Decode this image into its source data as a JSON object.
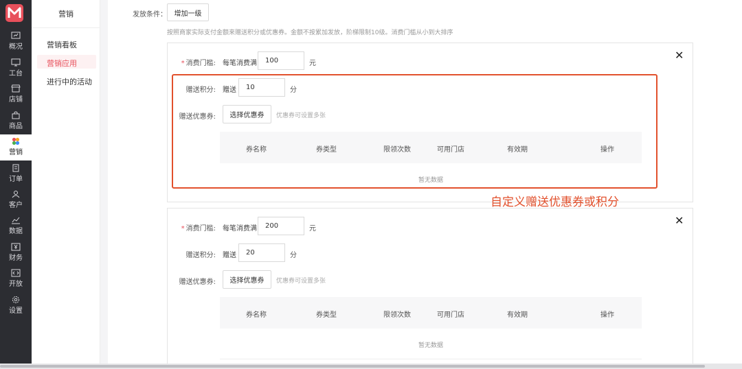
{
  "rail": {
    "items": [
      {
        "label": "概况",
        "icon": "overview-icon"
      },
      {
        "label": "工台",
        "icon": "monitor-icon"
      },
      {
        "label": "店铺",
        "icon": "store-icon"
      },
      {
        "label": "商品",
        "icon": "bag-icon"
      },
      {
        "label": "营销",
        "icon": "marketing-icon"
      },
      {
        "label": "订单",
        "icon": "order-icon"
      },
      {
        "label": "客户",
        "icon": "user-icon"
      },
      {
        "label": "数据",
        "icon": "chart-icon"
      },
      {
        "label": "财务",
        "icon": "finance-icon"
      },
      {
        "label": "开放",
        "icon": "code-icon"
      },
      {
        "label": "设置",
        "icon": "gear-icon"
      }
    ],
    "active": "营销"
  },
  "submenu": {
    "title": "营销",
    "items": [
      "营销看板",
      "营销应用",
      "进行中的活动"
    ],
    "active": "营销应用"
  },
  "form": {
    "condition_label": "发放条件：",
    "add_level_label": "增加一级",
    "hint": "按照商家实际支付金额来赠送积分或优惠券。金额不按累加发放，阶梯限制10级。消费门槛从小到大排序"
  },
  "levels": [
    {
      "threshold_label": "消费门槛:",
      "threshold_prefix": "每笔消费满",
      "threshold_value": "100",
      "threshold_unit": "元",
      "points_label": "赠送积分:",
      "points_prefix": "赠送",
      "points_value": "10",
      "points_unit": "分",
      "coupon_label": "赠送优惠券:",
      "coupon_button": "选择优惠券",
      "coupon_hint": "优惠券可设置多张",
      "empty_text": "暂无数据"
    },
    {
      "threshold_label": "消费门槛:",
      "threshold_prefix": "每笔消费满",
      "threshold_value": "200",
      "threshold_unit": "元",
      "points_label": "赠送积分:",
      "points_prefix": "赠送",
      "points_value": "20",
      "points_unit": "分",
      "coupon_label": "赠送优惠券:",
      "coupon_button": "选择优惠券",
      "coupon_hint": "优惠券可设置多张",
      "empty_text": "暂无数据"
    }
  ],
  "table_columns": [
    "券名称",
    "券类型",
    "限领次数",
    "可用门店",
    "有效期",
    "操作"
  ],
  "annotation": "自定义赠送优惠券或积分",
  "colors": {
    "accent": "#e8505b",
    "annotation": "#e2502c",
    "rail": "#2c2d32"
  }
}
